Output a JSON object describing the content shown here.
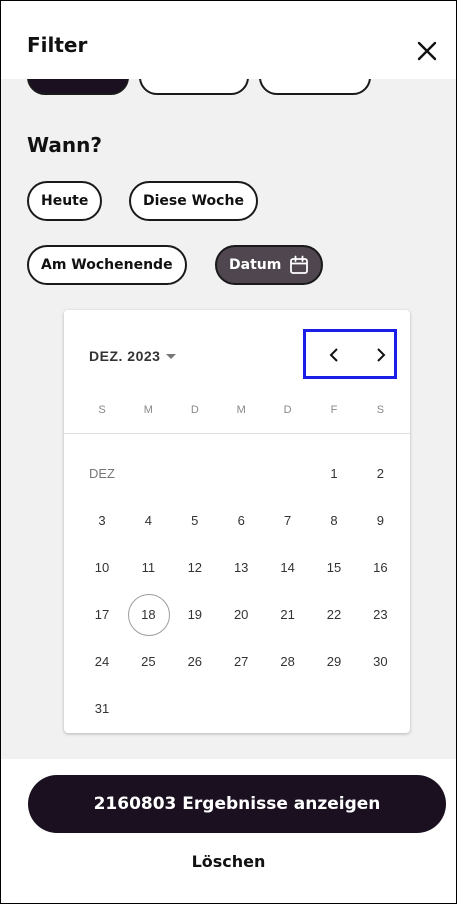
{
  "header": {
    "title": "Filter"
  },
  "when": {
    "title": "Wann?",
    "chips": [
      {
        "label": "Heute",
        "active": false
      },
      {
        "label": "Diese Woche",
        "active": false
      },
      {
        "label": "Am Wochenende",
        "active": false
      },
      {
        "label": "Datum",
        "active": true,
        "icon": "calendar-icon"
      }
    ]
  },
  "calendar": {
    "month_label": "DEZ. 2023",
    "weekdays": [
      "S",
      "M",
      "D",
      "M",
      "D",
      "F",
      "S"
    ],
    "month_short": "DEZ",
    "days": [
      "1",
      "2",
      "3",
      "4",
      "5",
      "6",
      "7",
      "8",
      "9",
      "10",
      "11",
      "12",
      "13",
      "14",
      "15",
      "16",
      "17",
      "18",
      "19",
      "20",
      "21",
      "22",
      "23",
      "24",
      "25",
      "26",
      "27",
      "28",
      "29",
      "30",
      "31"
    ],
    "first_weekday_index": 5,
    "today": "18"
  },
  "footer": {
    "results_button": "2160803 Ergebnisse anzeigen",
    "clear_label": "Löschen"
  },
  "colors": {
    "accent_dark": "#1a1020",
    "chip_active": "#4f4650",
    "highlight_box": "#1a1ee6"
  }
}
